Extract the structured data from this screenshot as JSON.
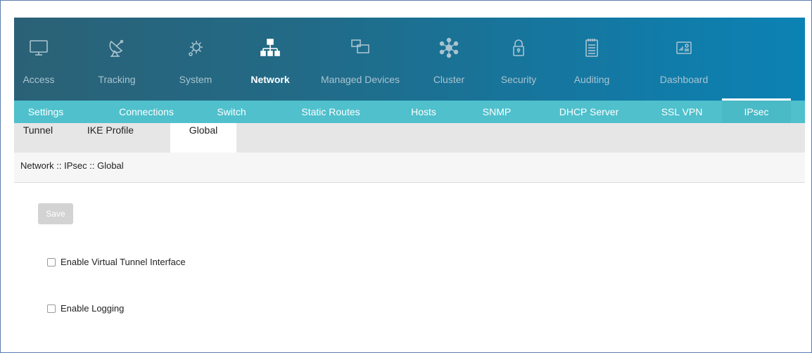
{
  "topnav": {
    "items": [
      {
        "label": "Access",
        "icon": "monitor-icon",
        "active": false
      },
      {
        "label": "Tracking",
        "icon": "satellite-dish-icon",
        "active": false
      },
      {
        "label": "System",
        "icon": "gear-icon",
        "active": false
      },
      {
        "label": "Network",
        "icon": "network-icon",
        "active": true
      },
      {
        "label": "Managed Devices",
        "icon": "devices-icon",
        "active": false
      },
      {
        "label": "Cluster",
        "icon": "cluster-icon",
        "active": false
      },
      {
        "label": "Security",
        "icon": "lock-icon",
        "active": false
      },
      {
        "label": "Auditing",
        "icon": "notepad-icon",
        "active": false
      },
      {
        "label": "Dashboard",
        "icon": "dashboard-icon",
        "active": false
      }
    ]
  },
  "subnav": {
    "items": [
      "Settings",
      "Connections",
      "Switch",
      "Static Routes",
      "Hosts",
      "SNMP",
      "DHCP Server",
      "SSL VPN",
      "IPsec"
    ],
    "active": "IPsec"
  },
  "tabs": {
    "items": [
      "Tunnel",
      "IKE Profile",
      "Global"
    ],
    "active": "Global"
  },
  "breadcrumb": "Network :: IPsec :: Global",
  "form": {
    "save_label": "Save",
    "enable_vti_label": "Enable Virtual Tunnel Interface",
    "enable_vti_checked": false,
    "enable_logging_label": "Enable Logging",
    "enable_logging_checked": false
  },
  "colors": {
    "nav_start": "#2b6176",
    "nav_end": "#0b82b4",
    "subnav": "#4fc0cc",
    "tabs_bg": "#e6e6e6",
    "button_disabled": "#d3d3d3"
  }
}
